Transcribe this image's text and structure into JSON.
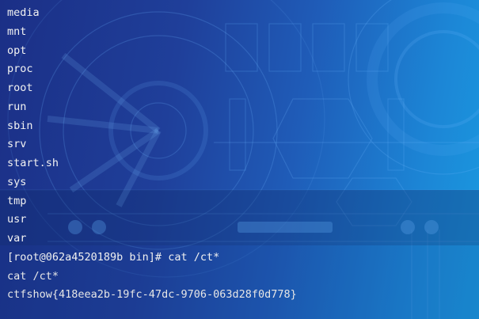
{
  "terminal": {
    "lines": [
      "media",
      "mnt",
      "opt",
      "proc",
      "root",
      "run",
      "sbin",
      "srv",
      "start.sh",
      "sys",
      "tmp",
      "usr",
      "var",
      "[root@062a4520189b bin]# cat /ct*",
      "cat /ct*",
      "ctfshow{418eea2b-19fc-47dc-9706-063d28f0d778}"
    ]
  },
  "colors": {
    "background_left": "#1b2f86",
    "background_right": "#1a9ae0",
    "text": "#e8e8e8"
  }
}
